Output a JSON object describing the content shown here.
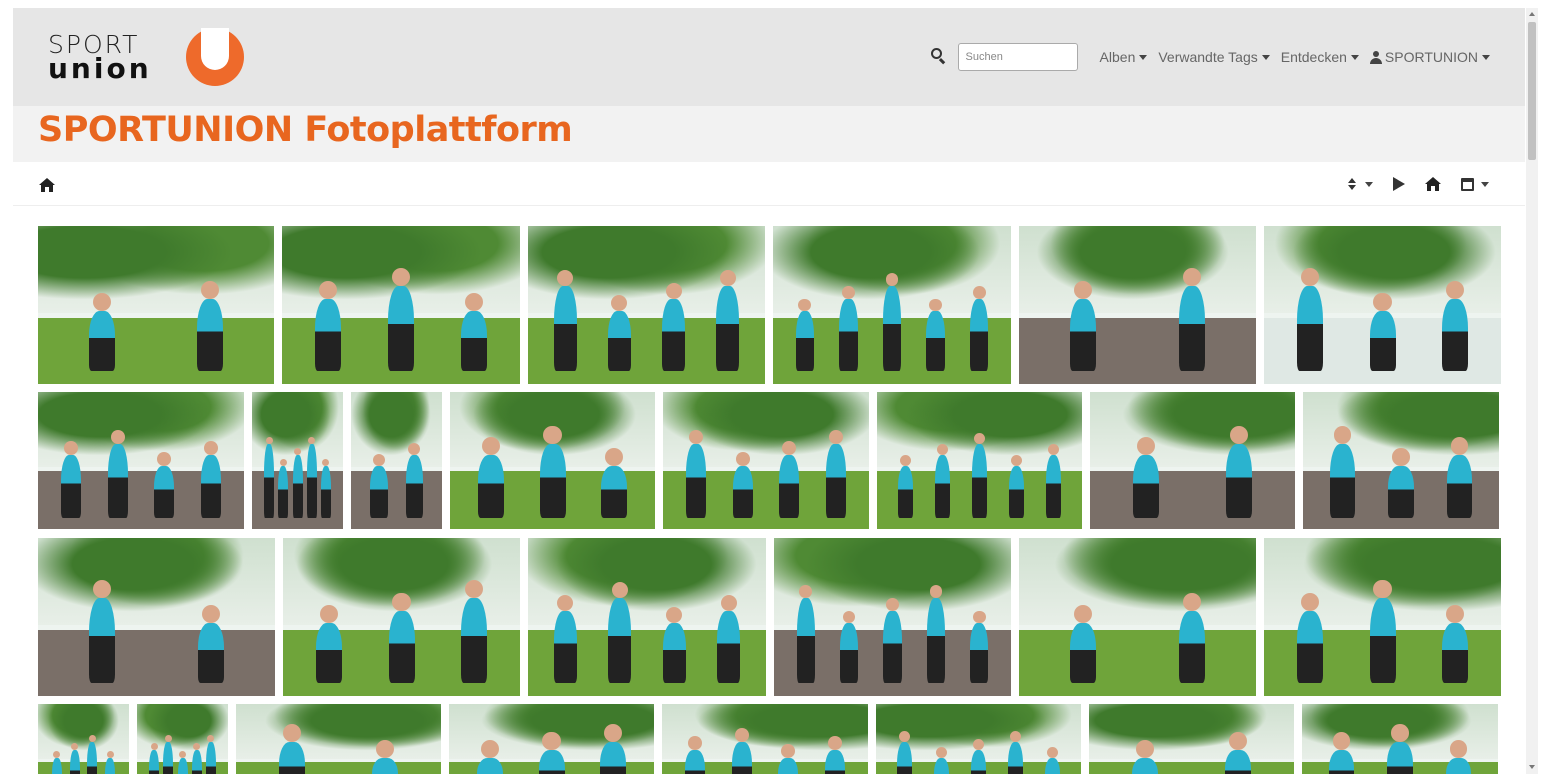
{
  "header": {
    "logo_top": "SPORT",
    "logo_bottom": "union",
    "search_placeholder": "Suchen",
    "nav": [
      {
        "label": "Alben"
      },
      {
        "label": "Verwandte Tags"
      },
      {
        "label": "Entdecken"
      },
      {
        "label": "SPORTUNION"
      }
    ]
  },
  "page": {
    "title": "SPORTUNION Fotoplattform"
  },
  "colors": {
    "brand": "#e8661f",
    "grass": "#6fa43a",
    "tree": "#3f7a2c",
    "sky": "#eef4f0",
    "deck": "#7a6f68",
    "shirt": "#2ab3cf",
    "tights": "#222222",
    "skin": "#d9a688"
  },
  "gallery": {
    "rows": [
      {
        "photos": [
          {
            "scene": "park-group-balance",
            "ground": "grass"
          },
          {
            "scene": "park-group-kick",
            "ground": "grass"
          },
          {
            "scene": "park-group-punch",
            "ground": "grass"
          },
          {
            "scene": "park-group-punch-close",
            "ground": "grass"
          },
          {
            "scene": "deck-pair-situp",
            "ground": "deck"
          },
          {
            "scene": "portrait-dumbbells",
            "ground": "sky"
          }
        ]
      },
      {
        "photos": [
          {
            "scene": "deck-balance",
            "ground": "deck"
          },
          {
            "scene": "deck-squat",
            "ground": "deck"
          },
          {
            "scene": "deck-stretch",
            "ground": "deck"
          },
          {
            "scene": "park-jump",
            "ground": "grass"
          },
          {
            "scene": "park-mountain-climber",
            "ground": "grass"
          },
          {
            "scene": "park-squat-group",
            "ground": "grass"
          },
          {
            "scene": "deck-pair-situp-2",
            "ground": "deck"
          },
          {
            "scene": "team-lineup",
            "ground": "deck"
          }
        ]
      },
      {
        "photos": [
          {
            "scene": "harbour-lunge",
            "ground": "deck"
          },
          {
            "scene": "park-squat-group-2",
            "ground": "grass"
          },
          {
            "scene": "park-yoga-group",
            "ground": "grass"
          },
          {
            "scene": "team-lineup-2",
            "ground": "deck"
          },
          {
            "scene": "park-lunge-group",
            "ground": "grass"
          },
          {
            "scene": "park-mountain-climber-2",
            "ground": "grass"
          }
        ]
      },
      {
        "photos": [
          {
            "scene": "deck-squat-2",
            "ground": "grass"
          },
          {
            "scene": "deck-stretch-2",
            "ground": "grass"
          },
          {
            "scene": "park-jump-2",
            "ground": "grass"
          },
          {
            "scene": "park-trees",
            "ground": "grass"
          },
          {
            "scene": "park-group-kick-2",
            "ground": "grass"
          },
          {
            "scene": "park-group-punch-2",
            "ground": "grass"
          },
          {
            "scene": "park-squat-group-3",
            "ground": "grass"
          },
          {
            "scene": "park-squat-group-4",
            "ground": "grass"
          }
        ]
      }
    ]
  }
}
